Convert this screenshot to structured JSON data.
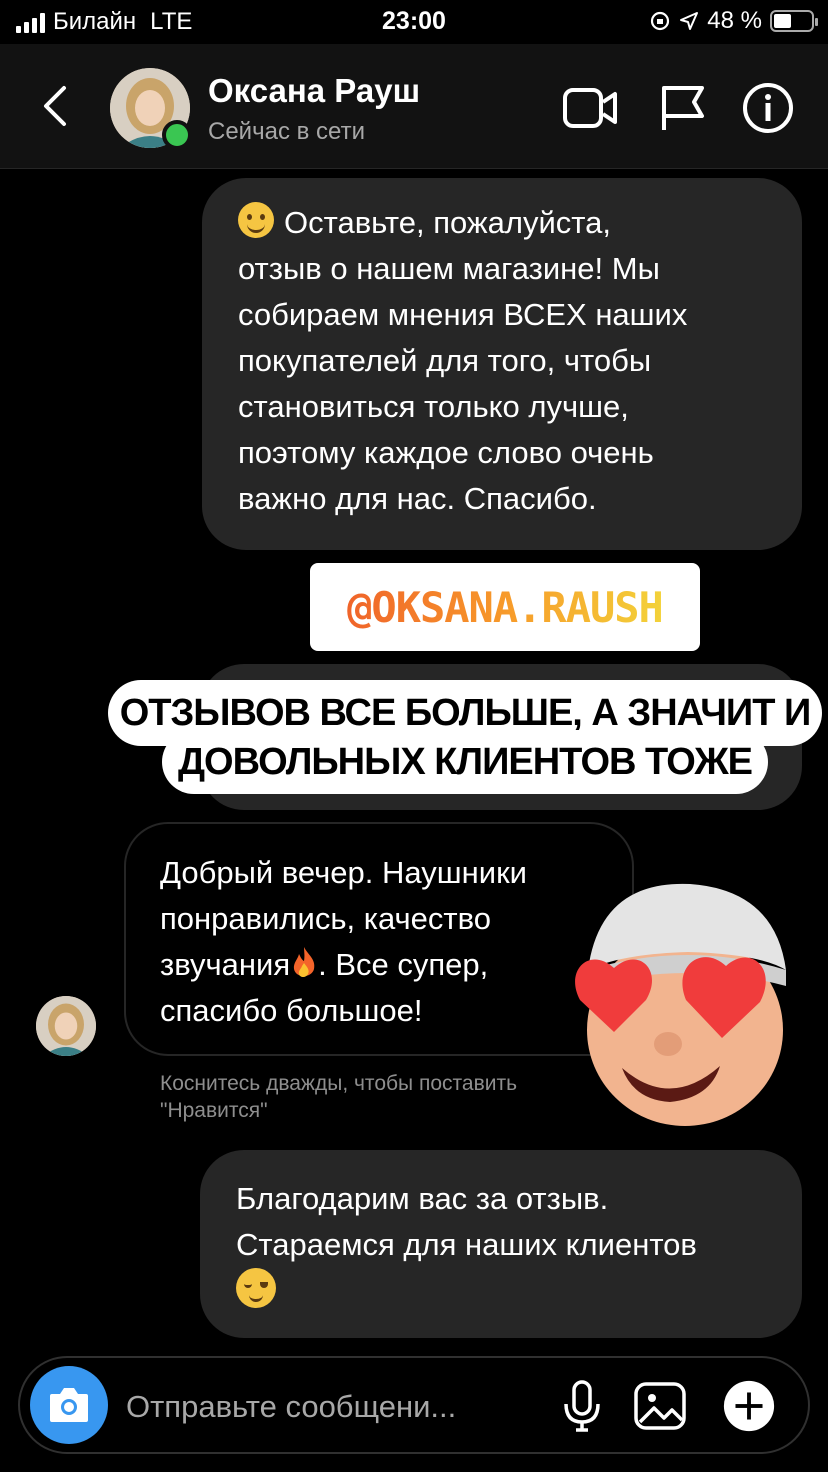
{
  "status_bar": {
    "carrier": "Билайн",
    "network": "LTE",
    "time": "23:00",
    "battery_percent": "48 %",
    "battery_level": 0.48
  },
  "header": {
    "contact_name": "Оксана Рауш",
    "contact_status": "Сейчас в сети",
    "icons": [
      "back-icon",
      "video-call-icon",
      "flag-icon",
      "info-icon"
    ]
  },
  "messages": [
    {
      "direction": "outgoing",
      "lines": [
        "Оставьте, пожалуйста,",
        "отзыв о нашем магазине! Мы",
        "собираем мнения ВСЕХ наших",
        "покупателей для того, чтобы",
        "становиться только лучше,",
        "поэтому каждое слово очень",
        "важно для нас. Спасибо."
      ],
      "emoji": "smiling-face-icon"
    },
    {
      "direction": "incoming",
      "lines": [
        "Добрый вечер. Наушники",
        "понравились, качество",
        "звучания",
        ". Все супер,",
        "спасибо большое!"
      ],
      "emoji": "fire-icon"
    },
    {
      "direction": "outgoing",
      "lines": [
        "Благодарим вас за отзыв.",
        "Стараемся для наших клиентов"
      ],
      "emoji": "relieved-face-icon"
    }
  ],
  "overlay": {
    "handle": "@OKSANA.RAUSH",
    "caption_line_1": "ОТЗЫВОВ ВСЕ БОЛЬШЕ, А ЗНАЧИТ И",
    "caption_line_2": "ДОВОЛЬНЫХ КЛИЕНТОВ ТОЖЕ",
    "sticker": "memoji-heart-eyes"
  },
  "like_hint": "Коснитесь дважды, чтобы поставить \"Нравится\"",
  "composer": {
    "placeholder": "Отправьте сообщени...",
    "icons": [
      "camera-icon",
      "microphone-icon",
      "gallery-icon",
      "plus-icon"
    ]
  },
  "colors": {
    "background": "#000000",
    "bubble": "#262626",
    "online": "#3ac652",
    "camera_button": "#3897f0"
  }
}
